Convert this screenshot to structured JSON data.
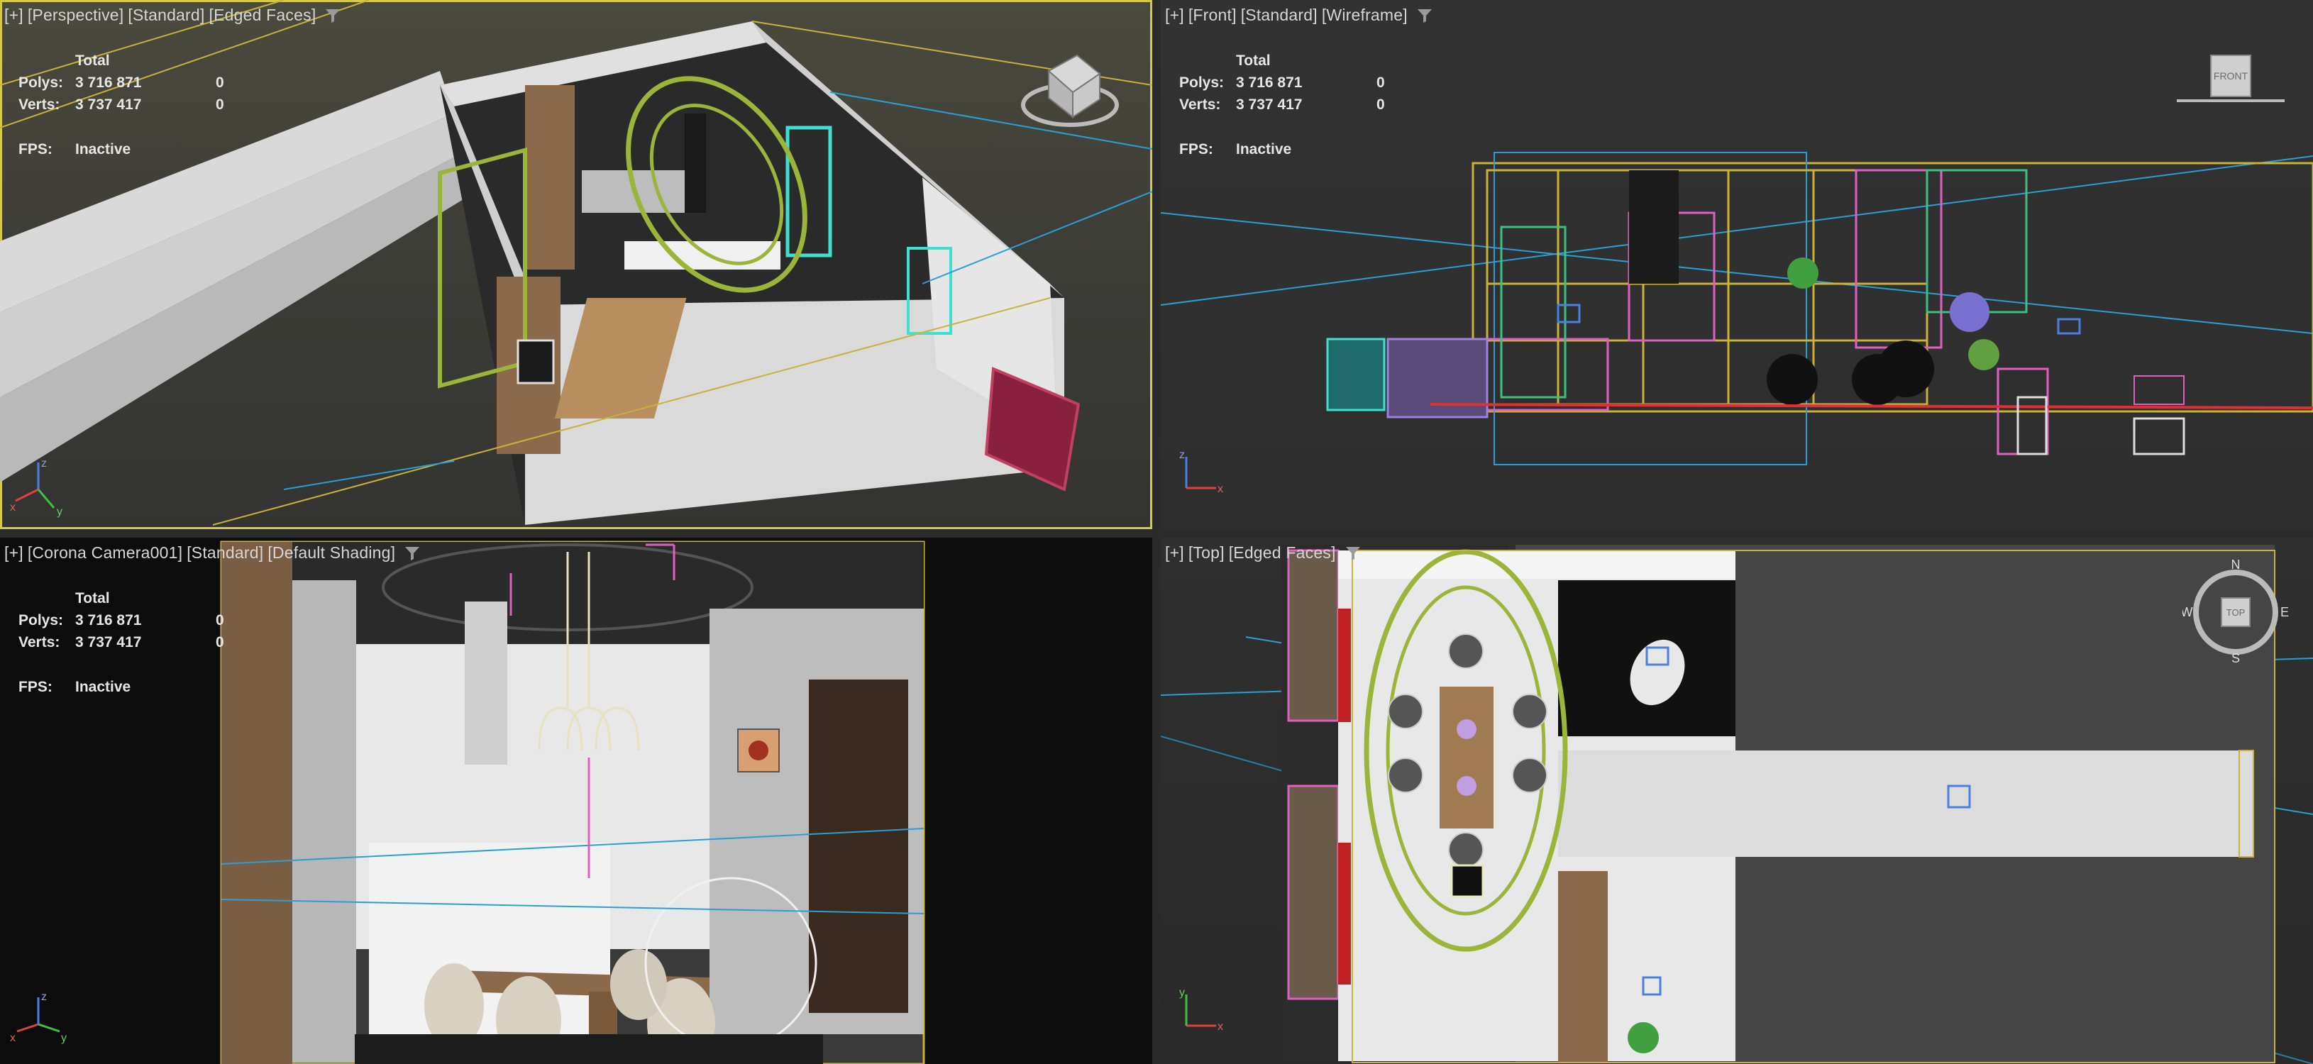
{
  "viewports": {
    "perspective": {
      "label_plus": "[+]",
      "label_view": "[Perspective]",
      "label_style": "[Standard]",
      "label_shading": "[Edged Faces]"
    },
    "front": {
      "label_plus": "[+]",
      "label_view": "[Front]",
      "label_style": "[Standard]",
      "label_shading": "[Wireframe]",
      "viewcube_face": "FRONT"
    },
    "camera": {
      "label_plus": "[+]",
      "label_view": "[Corona Camera001]",
      "label_style": "[Standard]",
      "label_shading": "[Default Shading]"
    },
    "top": {
      "label_plus": "[+]",
      "label_view": "[Top]",
      "label_style": "[Edged Faces]",
      "viewcube_face": "TOP",
      "compass": {
        "n": "N",
        "s": "S",
        "e": "E",
        "w": "W"
      }
    }
  },
  "stats": {
    "total_header": "Total",
    "polys_label": "Polys:",
    "polys_value": "3 716 871",
    "polys_sel": "0",
    "verts_label": "Verts:",
    "verts_value": "3 737 417",
    "verts_sel": "0",
    "fps_label": "FPS:",
    "fps_value": "Inactive"
  },
  "axis": {
    "x": "x",
    "y": "y",
    "z": "z"
  },
  "colors": {
    "active_border": "#d8c84a",
    "selection_green": "#9ab53a",
    "helper_blue": "#2a9fd6",
    "wire_yellow": "#c9b13a",
    "wire_pink": "#e060c0",
    "wire_cyan": "#40e0d0"
  }
}
